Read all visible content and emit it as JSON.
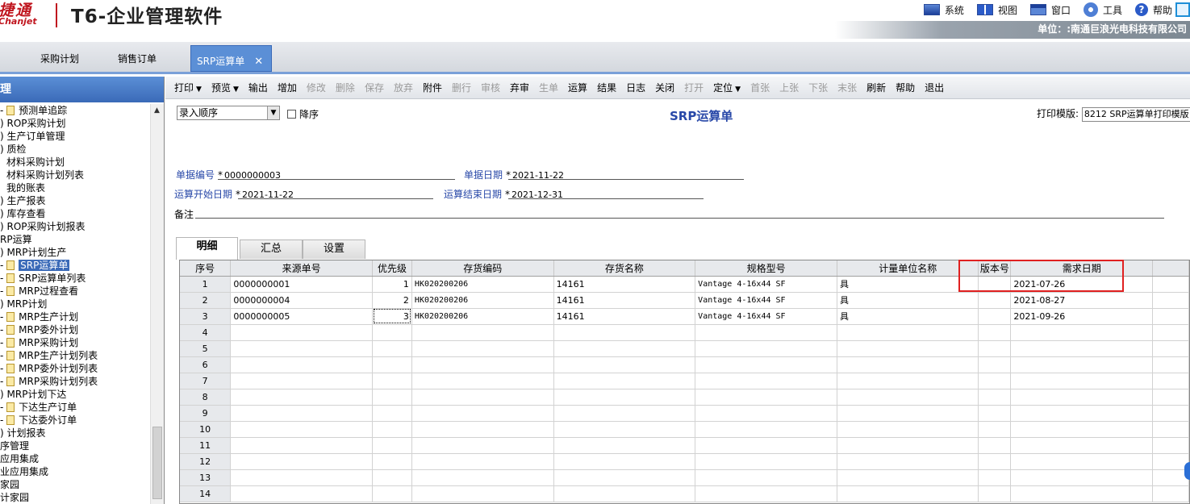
{
  "header": {
    "brand_zh": "捷通",
    "brand_en": "Chanjet",
    "app_title": "T6-企业管理软件",
    "menu": [
      {
        "label": "系统",
        "icon": "system-icon"
      },
      {
        "label": "视图",
        "icon": "view-icon"
      },
      {
        "label": "窗口",
        "icon": "window-icon"
      },
      {
        "label": "工具",
        "icon": "tools-icon"
      },
      {
        "label": "帮助",
        "icon": "help-icon"
      }
    ],
    "unit": "单位：:南通巨浪光电科技有限公司"
  },
  "tabs": [
    {
      "label": "采购计划"
    },
    {
      "label": "销售订单"
    },
    {
      "label": "SRP运算单",
      "active": true,
      "close": "✕"
    }
  ],
  "nav": {
    "title": "理",
    "items": [
      {
        "label": "预测单追踪",
        "indent": 1,
        "folder": true
      },
      {
        "label": "ROP采购计划",
        "indent": 0,
        "prefix": ")"
      },
      {
        "label": "生产订单管理",
        "indent": 0,
        "prefix": ")"
      },
      {
        "label": "质检",
        "indent": 0,
        "prefix": ")"
      },
      {
        "label": "材料采购计划",
        "indent": 1,
        "folder": false
      },
      {
        "label": "材料采购计划列表",
        "indent": 1,
        "folder": false
      },
      {
        "label": "我的账表",
        "indent": 1,
        "folder": false
      },
      {
        "label": "生产报表",
        "indent": 0,
        "prefix": ")"
      },
      {
        "label": "库存查看",
        "indent": 0,
        "prefix": ")"
      },
      {
        "label": "ROP采购计划报表",
        "indent": 0,
        "prefix": ")"
      },
      {
        "label": "RP运算",
        "indent": -1
      },
      {
        "label": "MRP计划生产",
        "indent": 0,
        "prefix": ")"
      },
      {
        "label": "SRP运算单",
        "indent": 1,
        "folder": true,
        "selected": true
      },
      {
        "label": "SRP运算单列表",
        "indent": 1,
        "folder": true
      },
      {
        "label": "MRP过程查看",
        "indent": 1,
        "folder": true
      },
      {
        "label": "MRP计划",
        "indent": 0,
        "prefix": ")"
      },
      {
        "label": "MRP生产计划",
        "indent": 1,
        "folder": true
      },
      {
        "label": "MRP委外计划",
        "indent": 1,
        "folder": true
      },
      {
        "label": "MRP采购计划",
        "indent": 1,
        "folder": true
      },
      {
        "label": "MRP生产计划列表",
        "indent": 1,
        "folder": true
      },
      {
        "label": "MRP委外计划列表",
        "indent": 1,
        "folder": true
      },
      {
        "label": "MRP采购计划列表",
        "indent": 1,
        "folder": true
      },
      {
        "label": "MRP计划下达",
        "indent": 0,
        "prefix": ")"
      },
      {
        "label": "下达生产订单",
        "indent": 1,
        "folder": true
      },
      {
        "label": "下达委外订单",
        "indent": 1,
        "folder": true
      },
      {
        "label": "计划报表",
        "indent": 0,
        "prefix": ")"
      },
      {
        "label": "序管理",
        "indent": -1
      },
      {
        "label": "应用集成",
        "indent": -1
      },
      {
        "label": "业应用集成",
        "indent": -1
      },
      {
        "label": "家园",
        "indent": -1
      },
      {
        "label": "计家园",
        "indent": -1
      }
    ]
  },
  "toolbar": [
    {
      "label": "打印",
      "dropdown": true
    },
    {
      "label": "预览",
      "dropdown": true
    },
    {
      "label": "输出"
    },
    {
      "label": "增加"
    },
    {
      "label": "修改",
      "disabled": true
    },
    {
      "label": "删除",
      "disabled": true
    },
    {
      "label": "保存",
      "disabled": true
    },
    {
      "label": "放弃",
      "disabled": true
    },
    {
      "label": "附件"
    },
    {
      "label": "删行",
      "disabled": true
    },
    {
      "label": "审核",
      "disabled": true
    },
    {
      "label": "弃审"
    },
    {
      "label": "生单",
      "disabled": true
    },
    {
      "label": "运算"
    },
    {
      "label": "结果"
    },
    {
      "label": "日志"
    },
    {
      "label": "关闭"
    },
    {
      "label": "打开",
      "disabled": true
    },
    {
      "label": "定位",
      "dropdown": true
    },
    {
      "label": "首张",
      "disabled": true
    },
    {
      "label": "上张",
      "disabled": true
    },
    {
      "label": "下张",
      "disabled": true
    },
    {
      "label": "末张",
      "disabled": true
    },
    {
      "label": "刷新"
    },
    {
      "label": "帮助"
    },
    {
      "label": "退出"
    }
  ],
  "form": {
    "order_select": "录入顺序",
    "descending_label": "降序",
    "title": "SRP运算单",
    "print_template_label": "打印模版:",
    "print_template_value": "8212 SRP运算单打印模版",
    "doc_no_label": "单据编号",
    "doc_no": "0000000003",
    "doc_date_label": "单据日期",
    "doc_date": "2021-11-22",
    "start_date_label": "运算开始日期",
    "start_date": "2021-11-22",
    "end_date_label": "运算结束日期",
    "end_date": "2021-12-31",
    "remark_label": "备注",
    "required_mark": "*"
  },
  "detail_tabs": [
    "明细",
    "汇总",
    "设置"
  ],
  "grid": {
    "columns": [
      "序号",
      "来源单号",
      "优先级",
      "存货编码",
      "存货名称",
      "规格型号",
      "计量单位名称",
      "版本号",
      "需求日期"
    ],
    "rows": [
      {
        "no": "1",
        "src": "0000000001",
        "prio": "1",
        "code": "HK020200206",
        "name": "14161",
        "spec": "Vantage 4-16x44 SF",
        "unit": "具",
        "ver": "",
        "date": "2021-07-26"
      },
      {
        "no": "2",
        "src": "0000000004",
        "prio": "2",
        "code": "HK020200206",
        "name": "14161",
        "spec": "Vantage 4-16x44 SF",
        "unit": "具",
        "ver": "",
        "date": "2021-08-27"
      },
      {
        "no": "3",
        "src": "0000000005",
        "prio": "3",
        "code": "HK020200206",
        "name": "14161",
        "spec": "Vantage 4-16x44 SF",
        "unit": "具",
        "ver": "",
        "date": "2021-09-26"
      }
    ],
    "empty_rows": [
      "4",
      "5",
      "6",
      "7",
      "8",
      "9",
      "10",
      "11",
      "12",
      "13",
      "14"
    ]
  }
}
